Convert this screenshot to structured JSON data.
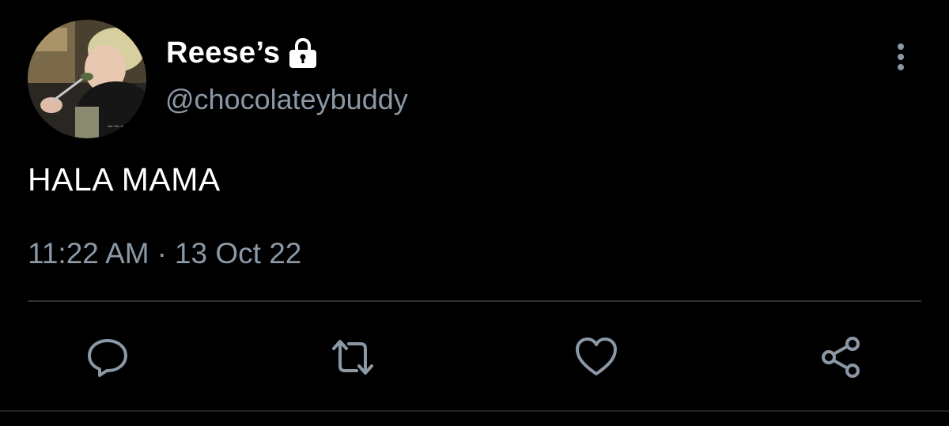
{
  "tweet": {
    "display_name": "Reese’s",
    "handle": "@chocolateybuddy",
    "text": "HALA MAMA",
    "time": "11:22 AM",
    "separator": "·",
    "date": "13 Oct 22"
  },
  "icons": {
    "lock": "lock-icon",
    "more": "more-vertical-icon",
    "reply": "reply-icon",
    "retweet": "retweet-icon",
    "like": "heart-icon",
    "share": "share-icon"
  },
  "colors": {
    "background": "#000000",
    "primary_text": "#ffffff",
    "secondary_text": "#8b98a5",
    "divider": "#2f3336"
  }
}
